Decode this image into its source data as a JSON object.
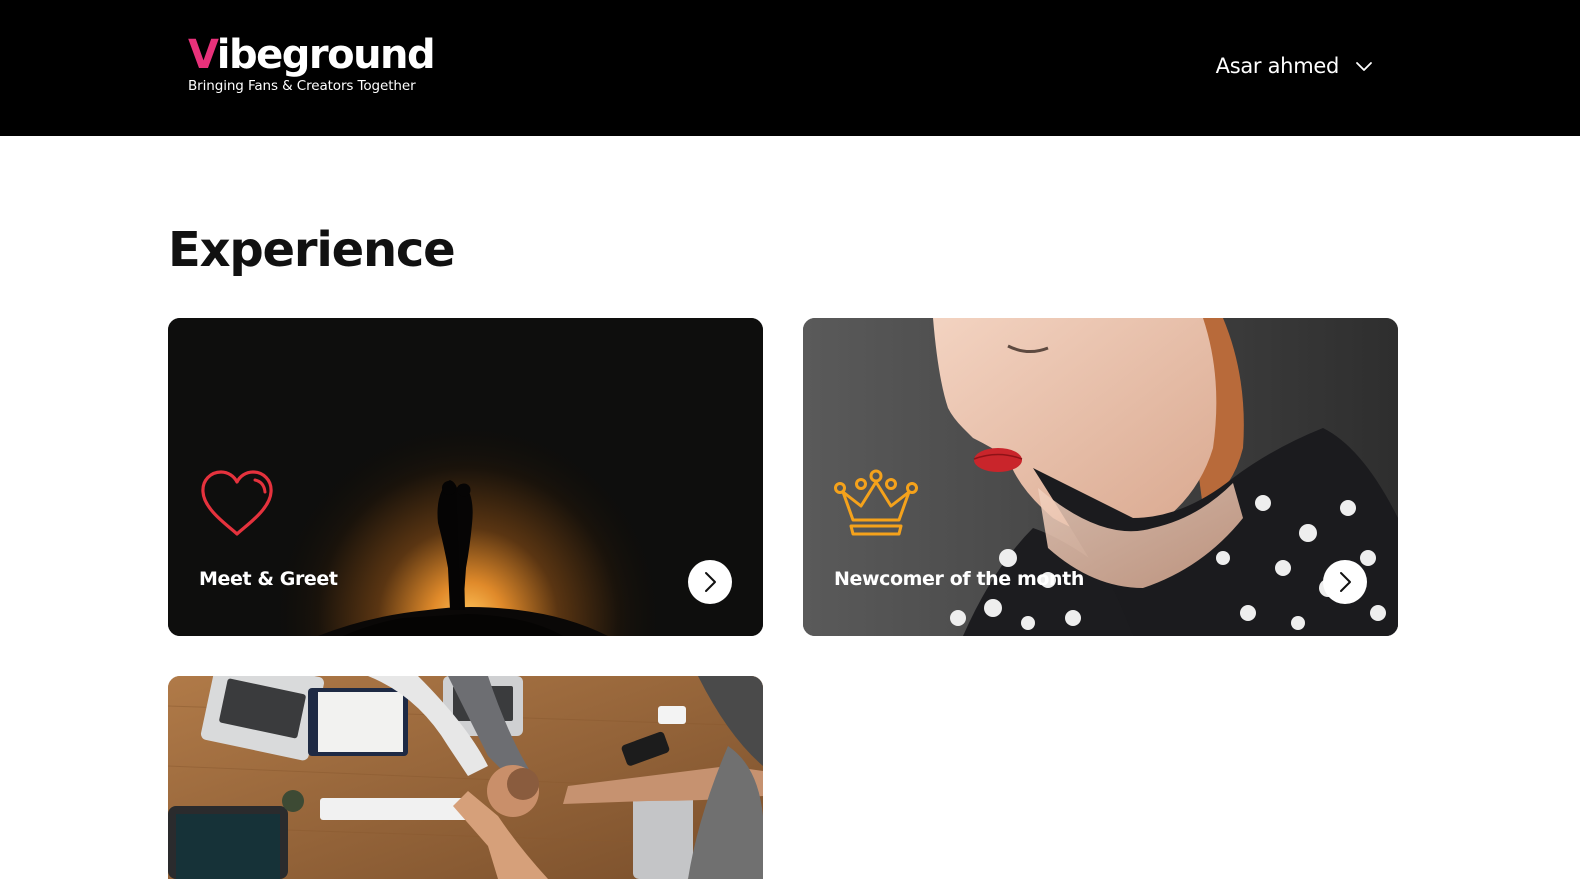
{
  "brand": {
    "logo_first_letter": "V",
    "logo_rest": "ibeground",
    "tagline": "Bringing Fans & Creators Together",
    "accent_color": "#e8317a"
  },
  "user_menu": {
    "name": "Asar ahmed",
    "icon": "chevron-down-icon"
  },
  "main": {
    "title": "Experience",
    "cards": [
      {
        "title": "Meet & Greet",
        "icon": "heart-icon",
        "icon_color": "#e5323d",
        "image": "couple silhouette at sunset"
      },
      {
        "title": "Newcomer of the month",
        "icon": "crown-icon",
        "icon_color": "#f5a21b",
        "image": "woman portrait with red lips"
      },
      {
        "title": "",
        "icon": "",
        "image": "team hands stacked on table"
      }
    ],
    "arrow_icon": "chevron-right-icon"
  }
}
